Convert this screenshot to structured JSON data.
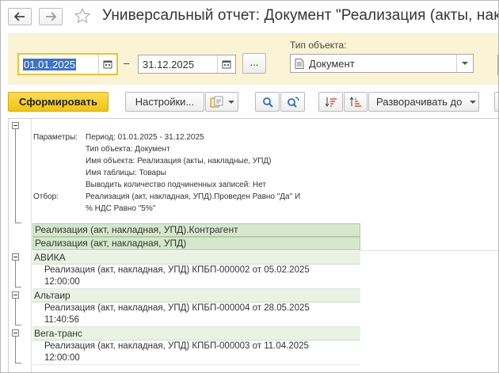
{
  "window": {
    "title": "Универсальный отчет: Документ \"Реализация (акты, накл."
  },
  "params": {
    "date_from": "01.01.2025",
    "date_separator": "–",
    "date_to": "31.12.2025",
    "period_choose_label": "...",
    "object_type_label": "Тип объекта:",
    "object_type_value": "Документ"
  },
  "toolbar": {
    "generate_label": "Сформировать",
    "settings_label": "Настройки...",
    "expand_label": "Разворачивать до"
  },
  "report": {
    "parameters_title": "Параметры:",
    "parameters": [
      "Период: 01.01.2025 - 31.12.2025",
      "Тип объекта: Документ",
      "Имя объекта: Реализация (акты, накладные, УПД)",
      "Имя таблицы: Товары",
      "Выводить количество подчиненных записей: Нет"
    ],
    "filter_title": "Отбор:",
    "filter_lines": [
      "Реализация (акт, накладная, УПД).Проведен Равно \"Да\" И",
      "% НДС Равно \"5%\""
    ],
    "headers": [
      "Реализация (акт, накладная, УПД).Контрагент",
      "Реализация (акт, накладная, УПД)"
    ],
    "groups": [
      {
        "name": "АВИКА",
        "doc_line1": "Реализация (акт, накладная, УПД) КПБП-000002 от 05.02.2025",
        "doc_line2": "12:00:00"
      },
      {
        "name": "Альтаир",
        "doc_line1": "Реализация (акт, накладная, УПД) КПБП-000004 от 28.05.2025",
        "doc_line2": "11:40:56"
      },
      {
        "name": "Вега-транс",
        "doc_line1": "Реализация (акт, накладная, УПД) КПБП-000003 от 11.04.2025",
        "doc_line2": "12:00:00"
      }
    ]
  },
  "icons": {
    "back": "arrow-left-icon",
    "forward": "arrow-right-icon",
    "favorite": "star-icon",
    "calendar": "calendar-icon",
    "document": "document-icon",
    "dropdown": "chevron-down-icon",
    "variant": "report-variant-icon",
    "search": "search-icon",
    "search_next": "search-next-icon",
    "sort_desc": "sort-descending-icon",
    "sort_asc": "sort-ascending-icon",
    "group_toggle": "collapse-minus-icon"
  },
  "colors": {
    "accent_button": "#f1c40f",
    "params_panel": "#faf3d4",
    "header_row": "#d5e8cc",
    "group_row": "#eaf2e4",
    "selection": "#3d72c8"
  }
}
